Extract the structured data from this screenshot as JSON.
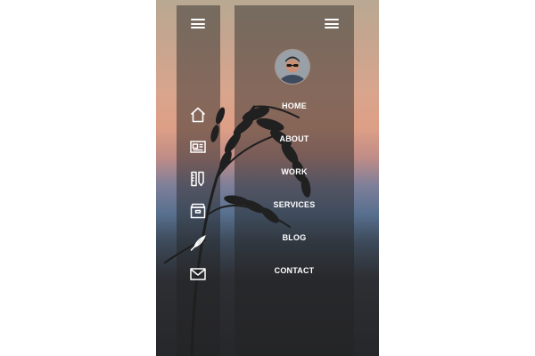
{
  "sidebar": {
    "icons": [
      {
        "name": "home-icon",
        "label": "Home"
      },
      {
        "name": "id-card-icon",
        "label": "About"
      },
      {
        "name": "tools-icon",
        "label": "Work"
      },
      {
        "name": "box-icon",
        "label": "Services"
      },
      {
        "name": "quill-icon",
        "label": "Blog"
      },
      {
        "name": "envelope-icon",
        "label": "Contact"
      }
    ]
  },
  "nav": {
    "items": [
      {
        "label": "HOME"
      },
      {
        "label": "ABOUT"
      },
      {
        "label": "WORK"
      },
      {
        "label": "SERVICES"
      },
      {
        "label": "BLOG"
      },
      {
        "label": "CONTACT"
      }
    ]
  },
  "theme": {
    "text_color": "#ffffff",
    "panel_color": "#222222"
  }
}
